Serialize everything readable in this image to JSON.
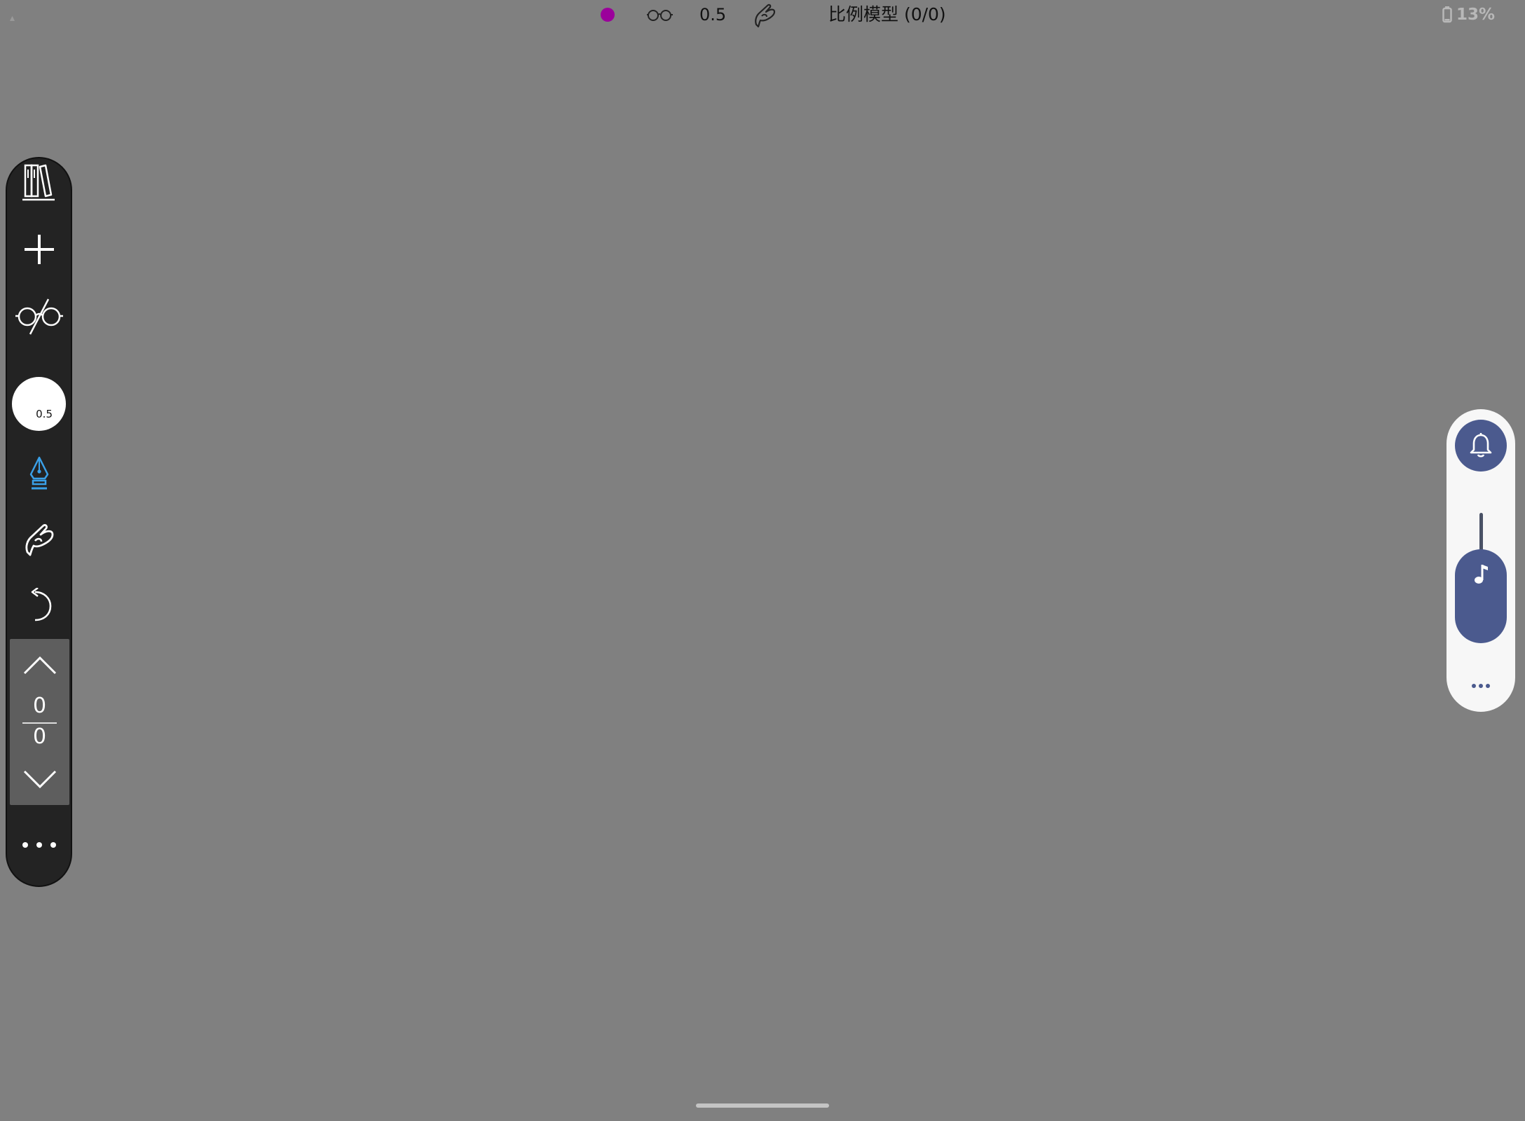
{
  "status_bar": {
    "current_color": "#9b009b",
    "brush_size": "0.5",
    "document_title": "比例模型 (0/0)",
    "battery_percent": "13%"
  },
  "toolbar": {
    "items": [
      {
        "name": "library",
        "icon": "books-icon"
      },
      {
        "name": "add",
        "icon": "plus-icon"
      },
      {
        "name": "view-mode",
        "icon": "glasses-slashed-icon"
      },
      {
        "name": "brush-size",
        "icon": "brush-circle",
        "value": "0.5"
      },
      {
        "name": "pen-tool",
        "icon": "pen-nib-icon",
        "active_color": "#3aa0e8"
      },
      {
        "name": "hand-tool",
        "icon": "hand-pinch-icon"
      },
      {
        "name": "undo",
        "icon": "undo-icon"
      }
    ],
    "pager": {
      "current": "0",
      "total": "0"
    },
    "more_icon": "more-dots-icon"
  },
  "side_panel": {
    "accent_color": "#4b5a8e",
    "items": [
      {
        "name": "notification",
        "icon": "bell-icon"
      },
      {
        "name": "media-volume",
        "icon": "music-note-icon"
      },
      {
        "name": "more",
        "icon": "more-dots-icon"
      }
    ]
  }
}
